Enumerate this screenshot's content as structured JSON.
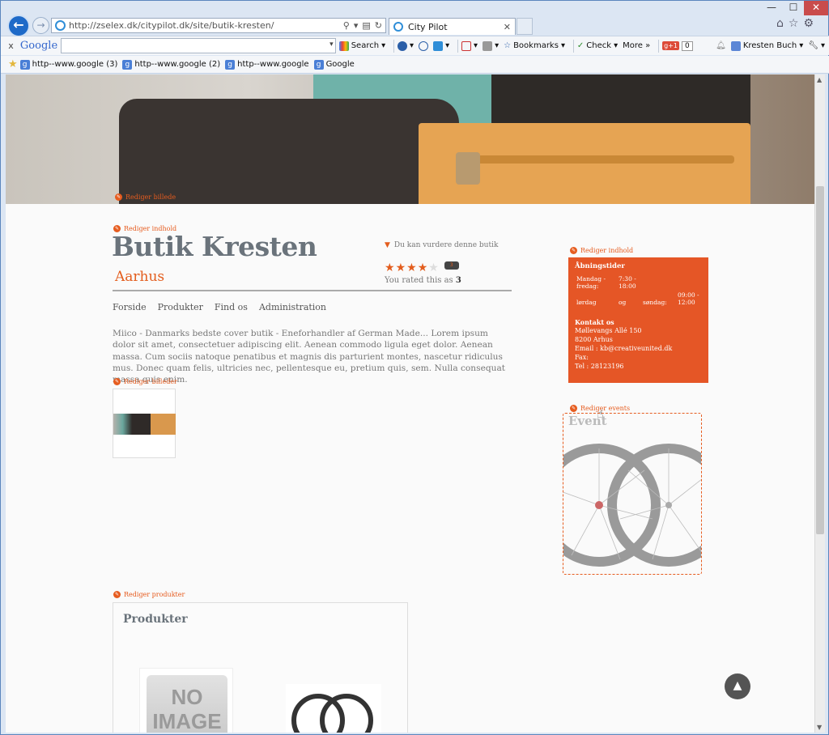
{
  "browser": {
    "window_controls": {
      "minimize": "—",
      "maximize": "☐",
      "close": "✕"
    },
    "url": "http://zselex.dk/citypilot.dk/site/butik-kresten/",
    "tab_title": "City Pilot",
    "google_toolbar": {
      "close": "x",
      "logo": "Google",
      "search_label": "Search",
      "bookmarks_label": "Bookmarks",
      "check_label": "Check",
      "more_label": "More »",
      "gplus": "g+1",
      "gplus_count": "0",
      "user_name": "Kresten Buch"
    },
    "favorites": [
      {
        "label": "http--www.google (3)"
      },
      {
        "label": "http--www.google (2)"
      },
      {
        "label": "http--www.google"
      },
      {
        "label": "Google"
      }
    ]
  },
  "page": {
    "hero_edit": "Rediger billede",
    "edit_content": "Rediger indhold",
    "shop_title": "Butik Kresten",
    "city": "Aarhus",
    "rate_hint": "Du kan vurdere denne butik",
    "rating": {
      "value": 4,
      "max": 5,
      "comment_count": "3"
    },
    "you_rated_prefix": "You rated this as",
    "you_rated_value": "3",
    "nav": [
      "Forside",
      "Produkter",
      "Find os",
      "Administration"
    ],
    "description": "Miico - Danmarks bedste cover butik - Eneforhandler af German Made... Lorem ipsum dolor sit amet, consectetuer adipiscing elit. Aenean commodo ligula eget dolor. Aenean massa. Cum sociis natoque penatibus et magnis dis parturient montes, nascetur ridiculus mus. Donec quam felis, ultricies nec, pellentesque eu, pretium quis, sem. Nulla consequat massa quis enim.",
    "edit_images": "Rediger billeder",
    "sidebar": {
      "edit_content": "Rediger indhold",
      "opening_hours_title": "Åbningstider",
      "hours": [
        {
          "day": "Mandag - fredag:",
          "time": "7:30 - 18:00"
        },
        {
          "day": "lørdag",
          "time": "og",
          "day2": "søndag:",
          "time2": "09:00 - 12:00"
        }
      ],
      "contact_title": "Kontakt os",
      "contact_lines": [
        "Møllevangs Allé 150",
        "8200 Arhus",
        "Email : kb@creativeunited.dk",
        "Fax:",
        "Tel : 28123196"
      ],
      "edit_events": "Rediger events",
      "events_title": "Event"
    },
    "edit_products": "Rediger produkter",
    "products_title": "Produkter",
    "no_image_text": "NO IMAGE",
    "to_top": "▲"
  },
  "colors": {
    "accent": "#e55626",
    "title": "#6a737b"
  }
}
